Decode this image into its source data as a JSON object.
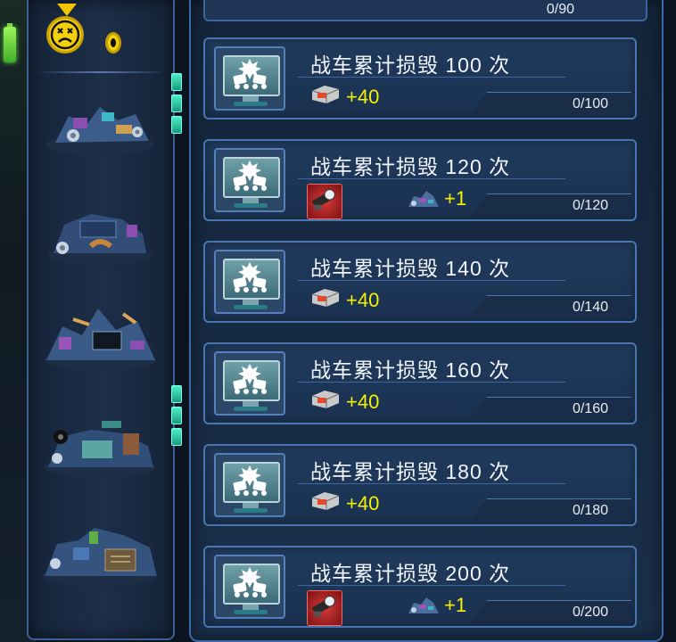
{
  "hud": {
    "coin_count_icon": "coin-icon",
    "medal_icon": "dizzy-face-medal-icon",
    "battery_icon": "battery-icon"
  },
  "previous_card": {
    "progress": "0/90"
  },
  "cards": [
    {
      "title": "战车累计损毁 100 次",
      "reward_type": "chip",
      "reward_amount": "+40",
      "progress": "0/100"
    },
    {
      "title": "战车累计损毁 120 次",
      "reward_type": "item-and-wreck",
      "reward_amount": "+1",
      "progress": "0/120"
    },
    {
      "title": "战车累计损毁 140 次",
      "reward_type": "chip",
      "reward_amount": "+40",
      "progress": "0/140"
    },
    {
      "title": "战车累计损毁 160 次",
      "reward_type": "chip",
      "reward_amount": "+40",
      "progress": "0/160"
    },
    {
      "title": "战车累计损毁 180 次",
      "reward_type": "chip",
      "reward_amount": "+40",
      "progress": "0/180"
    },
    {
      "title": "战车累计损毁 200 次",
      "reward_type": "item-and-wreck",
      "reward_amount": "+1",
      "progress": "0/200"
    }
  ],
  "colors": {
    "reward_text": "#f7f007",
    "panel_border": "#4a75b0",
    "card_bg": "#1a3150"
  }
}
